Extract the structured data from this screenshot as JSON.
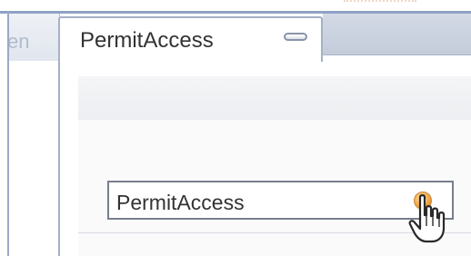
{
  "tabs": [
    {
      "label": "en",
      "active": false
    },
    {
      "label": "PermitAccess",
      "active": true
    }
  ],
  "field": {
    "value": "PermitAccess"
  },
  "colors": {
    "frame": "#8fa2c4",
    "tab_border": "#a5b1c7",
    "field_border": "#777f8c",
    "button_orange": "#f2a544"
  },
  "icons": {
    "tab_minimize": "minimize-icon",
    "field_button": "orange-circle-icon",
    "pointer": "hand-pointer-icon"
  }
}
